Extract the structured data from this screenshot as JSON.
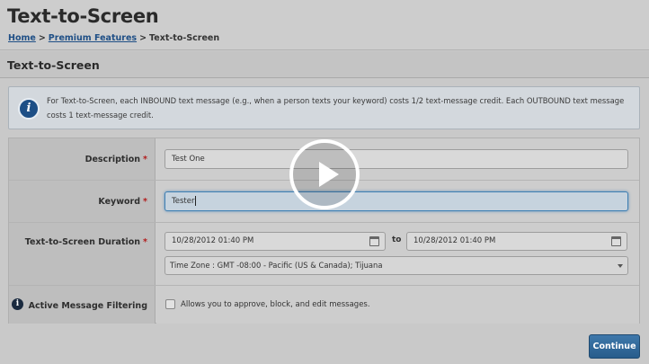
{
  "header": {
    "title": "Text-to-Screen",
    "breadcrumb": {
      "home": "Home",
      "separator": ">",
      "premium": "Premium Features",
      "current": "Text-to-Screen"
    }
  },
  "section": {
    "title": "Text-to-Screen"
  },
  "info": {
    "icon": "info-icon",
    "text": "For Text-to-Screen, each INBOUND text message (e.g., when a person texts your keyword) costs 1/2 text-message credit. Each OUTBOUND text message costs 1 text-message credit."
  },
  "form": {
    "description": {
      "label": "Description",
      "required": "*",
      "value": "Test One"
    },
    "keyword": {
      "label": "Keyword",
      "required": "*",
      "value": "Tester"
    },
    "duration": {
      "label": "Text-to-Screen Duration",
      "required": "*",
      "start": "10/28/2012 01:40 PM",
      "to": "to",
      "end": "10/28/2012 01:40 PM",
      "timezone": "Time Zone : GMT -08:00 - Pacific (US & Canada); Tijuana"
    },
    "filtering": {
      "label": "Active Message Filtering",
      "checked": false,
      "checkbox_label": "Allows you to approve, block, and edit messages."
    }
  },
  "actions": {
    "continue_label": "Continue"
  },
  "overlay": {
    "icon": "play-icon"
  },
  "colors": {
    "accent": "#285c8b",
    "required": "#b21e1e"
  }
}
